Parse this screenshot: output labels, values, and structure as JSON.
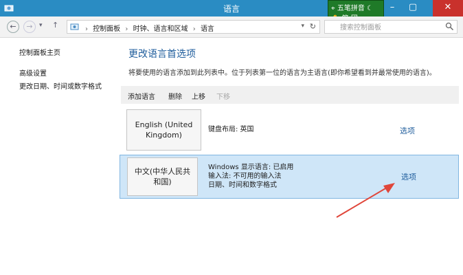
{
  "window": {
    "title": "语言"
  },
  "ime": {
    "name": "五笔拼音",
    "status": "简  团"
  },
  "addressbar": {
    "breadcrumbs": [
      "控制面板",
      "时钟、语言和区域",
      "语言"
    ],
    "search_placeholder": "搜索控制面板"
  },
  "sidebar": {
    "home": "控制面板主页",
    "items": [
      "高级设置",
      "更改日期、时间或数字格式"
    ]
  },
  "main": {
    "heading": "更改语言首选项",
    "description": "将要使用的语言添加到此列表中。位于列表第一位的语言为主语言(即你希望看到并最常使用的语言)。",
    "toolbar": {
      "add": "添加语言",
      "remove": "删除",
      "up": "上移",
      "down": "下移"
    },
    "languages": [
      {
        "name_line1": "English (United",
        "name_line2": "Kingdom)",
        "info": [
          "键盘布局: 英国"
        ],
        "options": "选项"
      },
      {
        "name_line1": "中文(中华人民共",
        "name_line2": "和国)",
        "info": [
          "Windows 显示语言: 已启用",
          "输入法: 不可用的输入法",
          "日期、时间和数字格式"
        ],
        "options": "选项"
      }
    ]
  },
  "colors": {
    "titlebar": "#2a8cc3",
    "link": "#1f5d9c",
    "selected_row": "#cfe6f8",
    "annotation_arrow": "#e0463a"
  }
}
